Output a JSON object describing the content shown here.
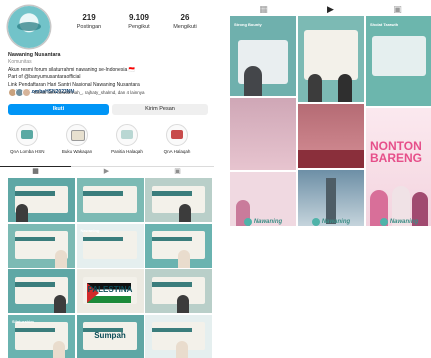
{
  "profile": {
    "stats": [
      {
        "num": "219",
        "label": "Postingan"
      },
      {
        "num": "9.109",
        "label": "Pengikut"
      },
      {
        "num": "26",
        "label": "Mengikuti"
      }
    ],
    "name": "Nawaning Nusantara",
    "category": "Komunitas",
    "bio": [
      "Akun resmi forum silaturrahmi nawaning se-Indonesia 🇮🇩",
      "Part of @banyumusantaraofficial",
      "Link Pendaftaran Hari Santri Nasional Nawaning Nusantara"
    ],
    "link": "bit.ly/LombaHSN2023NN",
    "followed_by": "Diikuti oleh dewiariviah_, rajhaty_shalmd, dan 4 lainnya",
    "follow_button": "Ikuti",
    "message_button": "Kirim Pesan"
  },
  "highlights": [
    {
      "label": "QnA Lomba HSN",
      "icon": "chat-icon",
      "color": "#5aa9a3"
    },
    {
      "label": "Buku Wakaqan",
      "icon": "book-icon",
      "color": "#e7e0cf"
    },
    {
      "label": "Panitia Halaqah",
      "icon": "people-icon",
      "color": "#b9d7d3"
    },
    {
      "label": "QnA Halaqah",
      "icon": "chat-icon",
      "color": "#c84b4b"
    }
  ],
  "tabs": [
    {
      "icon": "grid-icon",
      "glyph": "▦"
    },
    {
      "icon": "reels-icon",
      "glyph": "▶"
    },
    {
      "icon": "tagged-icon",
      "glyph": "▣"
    }
  ],
  "posts": [
    {
      "theme": "t1",
      "tag": "",
      "big": ""
    },
    {
      "theme": "t2",
      "tag": "",
      "big": ""
    },
    {
      "theme": "t3",
      "tag": "",
      "big": ""
    },
    {
      "theme": "t2",
      "tag": "",
      "big": ""
    },
    {
      "theme": "t4",
      "tag": "Nawaning",
      "big": ""
    },
    {
      "theme": "t5",
      "tag": "",
      "big": ""
    },
    {
      "theme": "t1",
      "tag": "",
      "big": ""
    },
    {
      "theme": "t6",
      "tag": "",
      "big": "PALESTINA"
    },
    {
      "theme": "t3",
      "tag": "",
      "big": ""
    },
    {
      "theme": "t5",
      "tag": "Silaturahim",
      "big": ""
    },
    {
      "theme": "t1",
      "tag": "",
      "big": "Sumpah"
    },
    {
      "theme": "t4",
      "tag": "",
      "big": ""
    }
  ],
  "right": {
    "tabs": [
      {
        "icon": "grid-icon",
        "glyph": "▦"
      },
      {
        "icon": "reels-icon",
        "glyph": "▶"
      },
      {
        "icon": "tagged-icon",
        "glyph": "▣"
      }
    ],
    "columns": [
      {
        "label": "Strong Bounty",
        "play": "",
        "logo": "Nawaning"
      },
      {
        "label": "",
        "play": "",
        "logo": "Nawaning"
      },
      {
        "label": "Sholat Tarawih",
        "play": "",
        "logo": "Nawaning"
      }
    ],
    "nonton": "NONTON BARENG"
  }
}
